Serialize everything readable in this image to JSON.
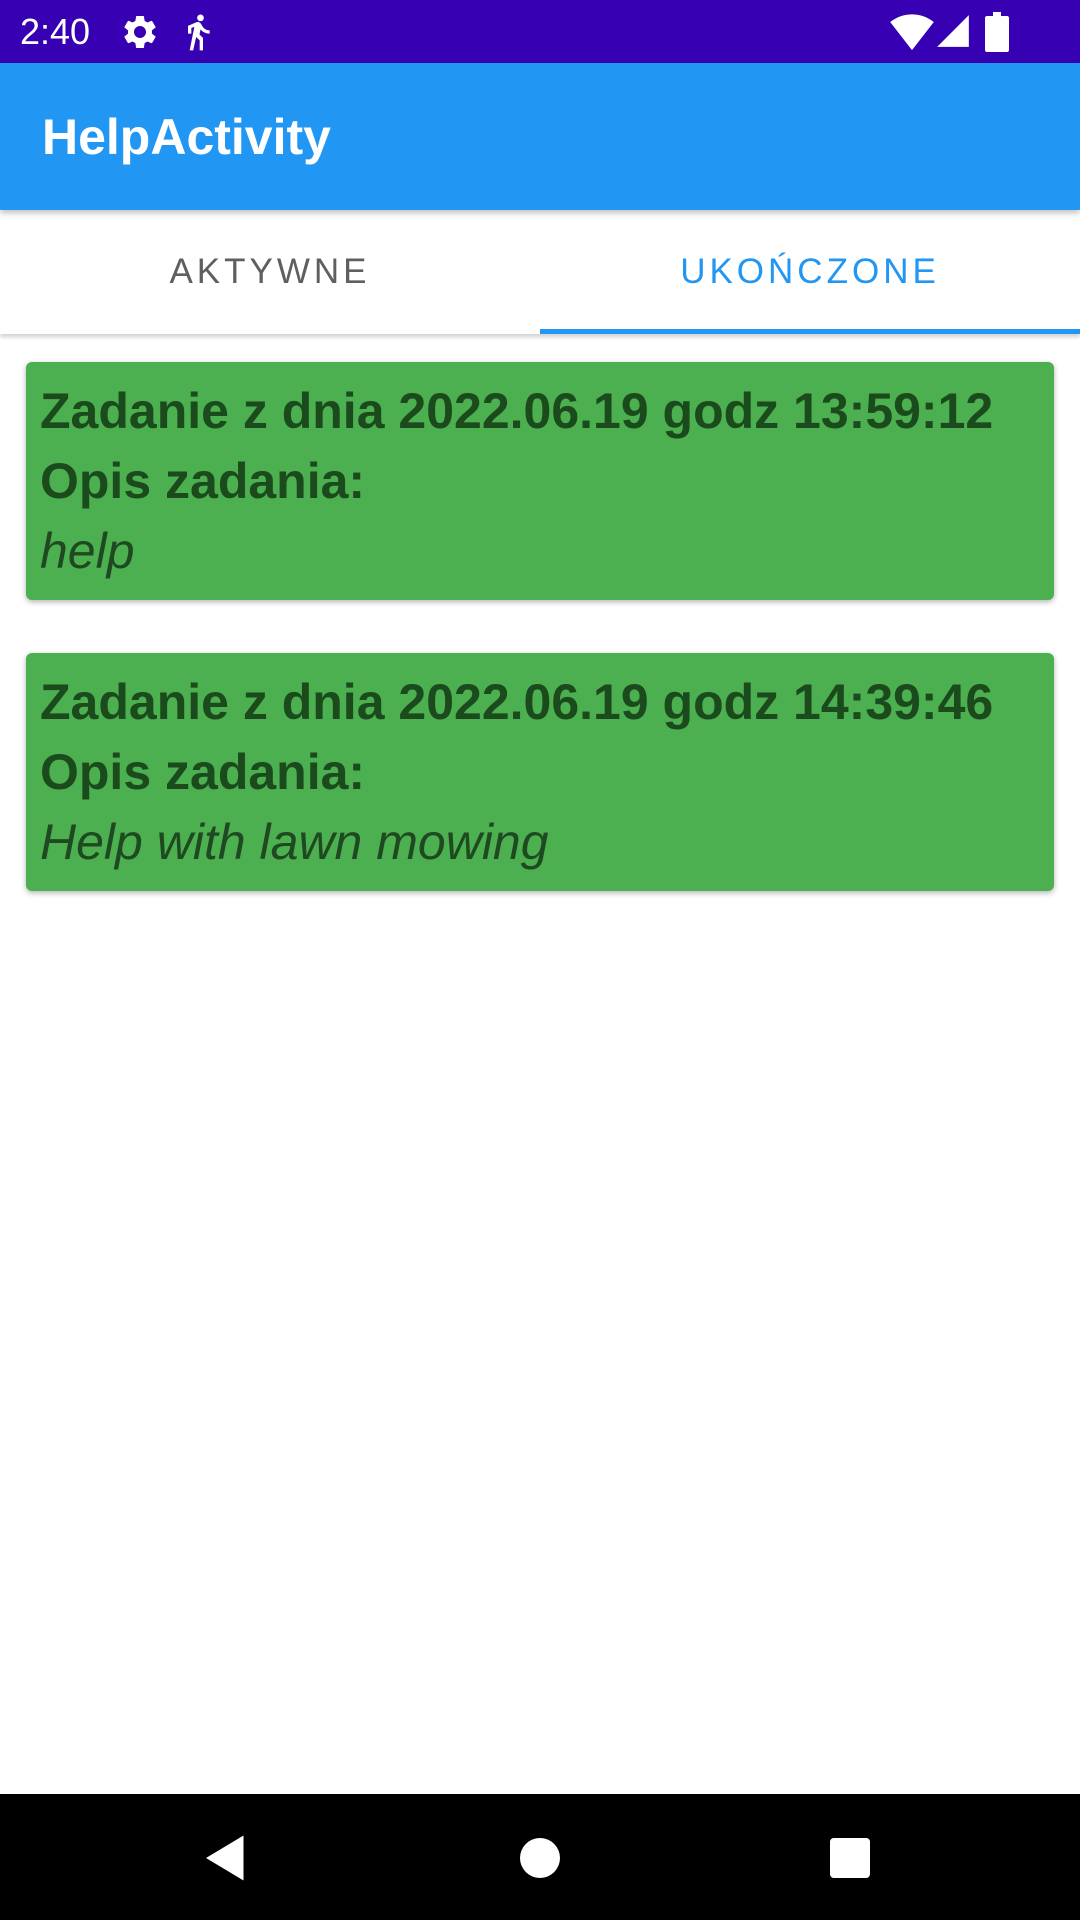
{
  "status_bar": {
    "time": "2:40",
    "left_icons": [
      "settings-icon",
      "accessibility-icon"
    ],
    "right_icons": [
      "wifi-icon",
      "signal-icon",
      "battery-icon"
    ],
    "background": "#3700b3"
  },
  "app_bar": {
    "title": "HelpActivity",
    "background": "#2196f3"
  },
  "tabs": [
    {
      "label": "AKTYWNE",
      "selected": false
    },
    {
      "label": "UKOŃCZONE",
      "selected": true
    }
  ],
  "accent_color": "#2196f3",
  "tasks": [
    {
      "title": "Zadanie z dnia 2022.06.19 godz 13:59:12",
      "desc_label": "Opis zadania:",
      "description": "help"
    },
    {
      "title": "Zadanie z dnia 2022.06.19 godz 14:39:46",
      "desc_label": "Opis zadania:",
      "description": "Help with lawn mowing"
    }
  ],
  "card_color": "#4caf50",
  "nav_bar": {
    "buttons": [
      "back-icon",
      "home-icon",
      "recents-icon"
    ]
  }
}
